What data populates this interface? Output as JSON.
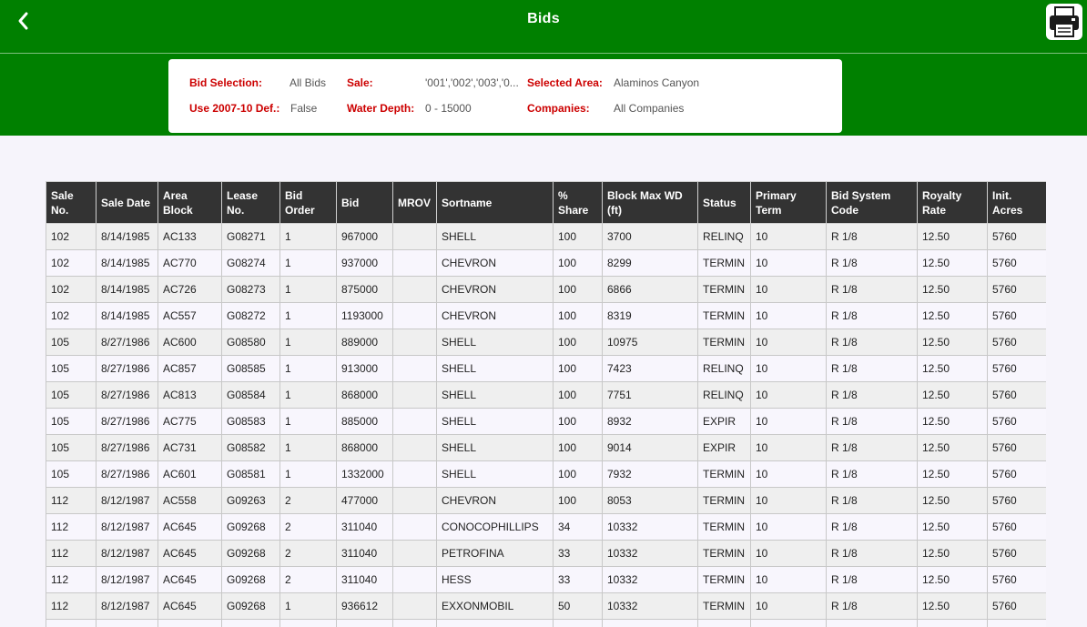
{
  "header": {
    "title": "Bids",
    "back_icon": "chevron-left-icon",
    "print_icon": "printer-icon",
    "colors": {
      "bar": "#008000",
      "label_red": "#cc0000",
      "table_header": "#333333"
    }
  },
  "filters": {
    "bid_selection_label": "Bid Selection:",
    "bid_selection_value": "All Bids",
    "sale_label": "Sale:",
    "sale_value": "'001','002','003','0...",
    "selected_area_label": "Selected Area:",
    "selected_area_value": "Alaminos Canyon",
    "use_def_label": "Use 2007-10 Def.:",
    "use_def_value": "False",
    "water_depth_label": "Water Depth:",
    "water_depth_value": "0 - 15000",
    "companies_label": "Companies:",
    "companies_value": "All Companies"
  },
  "table": {
    "columns": [
      [
        "Sale",
        "No."
      ],
      [
        "Sale Date",
        ""
      ],
      [
        "Area",
        "Block"
      ],
      [
        "Lease",
        "No."
      ],
      [
        "Bid",
        "Order"
      ],
      [
        "Bid",
        ""
      ],
      [
        "MROV",
        ""
      ],
      [
        "Sortname",
        ""
      ],
      [
        "%",
        "Share"
      ],
      [
        "Block Max WD",
        "(ft)"
      ],
      [
        "Status",
        ""
      ],
      [
        "Primary",
        "Term"
      ],
      [
        "Bid System",
        "Code"
      ],
      [
        "Royalty",
        "Rate"
      ],
      [
        "Init.",
        "Acres"
      ]
    ],
    "rows": [
      [
        "102",
        "8/14/1985",
        "AC133",
        "G08271",
        "1",
        "967000",
        "",
        "SHELL",
        "100",
        "3700",
        "RELINQ",
        "10",
        "R 1/8",
        "12.50",
        "5760"
      ],
      [
        "102",
        "8/14/1985",
        "AC770",
        "G08274",
        "1",
        "937000",
        "",
        "CHEVRON",
        "100",
        "8299",
        "TERMIN",
        "10",
        "R 1/8",
        "12.50",
        "5760"
      ],
      [
        "102",
        "8/14/1985",
        "AC726",
        "G08273",
        "1",
        "875000",
        "",
        "CHEVRON",
        "100",
        "6866",
        "TERMIN",
        "10",
        "R 1/8",
        "12.50",
        "5760"
      ],
      [
        "102",
        "8/14/1985",
        "AC557",
        "G08272",
        "1",
        "1193000",
        "",
        "CHEVRON",
        "100",
        "8319",
        "TERMIN",
        "10",
        "R 1/8",
        "12.50",
        "5760"
      ],
      [
        "105",
        "8/27/1986",
        "AC600",
        "G08580",
        "1",
        "889000",
        "",
        "SHELL",
        "100",
        "10975",
        "TERMIN",
        "10",
        "R 1/8",
        "12.50",
        "5760"
      ],
      [
        "105",
        "8/27/1986",
        "AC857",
        "G08585",
        "1",
        "913000",
        "",
        "SHELL",
        "100",
        "7423",
        "RELINQ",
        "10",
        "R 1/8",
        "12.50",
        "5760"
      ],
      [
        "105",
        "8/27/1986",
        "AC813",
        "G08584",
        "1",
        "868000",
        "",
        "SHELL",
        "100",
        "7751",
        "RELINQ",
        "10",
        "R 1/8",
        "12.50",
        "5760"
      ],
      [
        "105",
        "8/27/1986",
        "AC775",
        "G08583",
        "1",
        "885000",
        "",
        "SHELL",
        "100",
        "8932",
        "EXPIR",
        "10",
        "R 1/8",
        "12.50",
        "5760"
      ],
      [
        "105",
        "8/27/1986",
        "AC731",
        "G08582",
        "1",
        "868000",
        "",
        "SHELL",
        "100",
        "9014",
        "EXPIR",
        "10",
        "R 1/8",
        "12.50",
        "5760"
      ],
      [
        "105",
        "8/27/1986",
        "AC601",
        "G08581",
        "1",
        "1332000",
        "",
        "SHELL",
        "100",
        "7932",
        "TERMIN",
        "10",
        "R 1/8",
        "12.50",
        "5760"
      ],
      [
        "112",
        "8/12/1987",
        "AC558",
        "G09263",
        "2",
        "477000",
        "",
        "CHEVRON",
        "100",
        "8053",
        "TERMIN",
        "10",
        "R 1/8",
        "12.50",
        "5760"
      ],
      [
        "112",
        "8/12/1987",
        "AC645",
        "G09268",
        "2",
        "311040",
        "",
        "CONOCOPHILLIPS",
        "34",
        "10332",
        "TERMIN",
        "10",
        "R 1/8",
        "12.50",
        "5760"
      ],
      [
        "112",
        "8/12/1987",
        "AC645",
        "G09268",
        "2",
        "311040",
        "",
        "PETROFINA",
        "33",
        "10332",
        "TERMIN",
        "10",
        "R 1/8",
        "12.50",
        "5760"
      ],
      [
        "112",
        "8/12/1987",
        "AC645",
        "G09268",
        "2",
        "311040",
        "",
        "HESS",
        "33",
        "10332",
        "TERMIN",
        "10",
        "R 1/8",
        "12.50",
        "5760"
      ],
      [
        "112",
        "8/12/1987",
        "AC645",
        "G09268",
        "1",
        "936612",
        "",
        "EXXONMOBIL",
        "50",
        "10332",
        "TERMIN",
        "10",
        "R 1/8",
        "12.50",
        "5760"
      ],
      [
        "",
        "",
        "",
        "",
        "",
        "",
        "",
        "",
        "",
        "",
        "",
        "",
        "",
        "",
        ""
      ]
    ]
  }
}
